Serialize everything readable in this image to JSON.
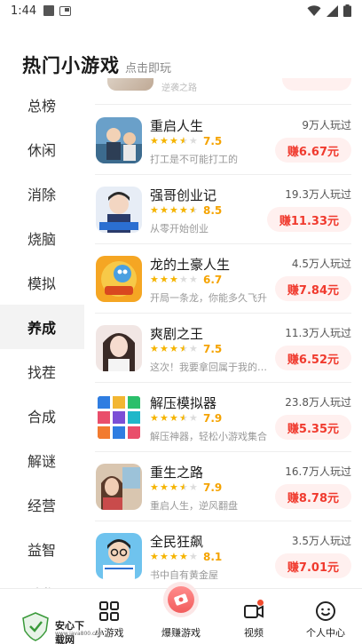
{
  "status_bar": {
    "time": "1:44"
  },
  "header": {
    "title": "热门小游戏",
    "subtitle": "点击即玩"
  },
  "categories": [
    {
      "label": "总榜"
    },
    {
      "label": "休闲"
    },
    {
      "label": "消除"
    },
    {
      "label": "烧脑"
    },
    {
      "label": "模拟"
    },
    {
      "label": "养成",
      "active": true
    },
    {
      "label": "找茬"
    },
    {
      "label": "合成"
    },
    {
      "label": "解谜"
    },
    {
      "label": "经营"
    },
    {
      "label": "益智"
    },
    {
      "label": "动作"
    }
  ],
  "top_partial": {
    "desc": "逆袭之路"
  },
  "games": [
    {
      "name": "重启人生",
      "rating": "7.5",
      "stars": [
        1,
        1,
        1,
        0.5,
        0
      ],
      "desc": "打工是不可能打工的",
      "players": "9万人玩过",
      "earn": "赚6.67元"
    },
    {
      "name": "强哥创业记",
      "rating": "8.5",
      "stars": [
        1,
        1,
        1,
        1,
        0.5
      ],
      "desc": "从零开始创业",
      "players": "19.3万人玩过",
      "earn": "赚11.33元"
    },
    {
      "name": "龙的土豪人生",
      "rating": "6.7",
      "stars": [
        1,
        1,
        1,
        0,
        0
      ],
      "desc": "开局一条龙，你能多久飞升",
      "players": "4.5万人玩过",
      "earn": "赚7.84元"
    },
    {
      "name": "爽剧之王",
      "rating": "7.5",
      "stars": [
        1,
        1,
        1,
        0.5,
        0
      ],
      "desc": "这次！我要拿回属于我的一切",
      "players": "11.3万人玩过",
      "earn": "赚6.52元"
    },
    {
      "name": "解压模拟器",
      "rating": "7.9",
      "stars": [
        1,
        1,
        1,
        0.5,
        0
      ],
      "desc": "解压神器，轻松小游戏集合",
      "players": "23.8万人玩过",
      "earn": "赚5.35元"
    },
    {
      "name": "重生之路",
      "rating": "7.9",
      "stars": [
        1,
        1,
        1,
        0.5,
        0
      ],
      "desc": "重启人生，逆风翻盘",
      "players": "16.7万人玩过",
      "earn": "赚8.78元"
    },
    {
      "name": "全民狂飙",
      "rating": "8.1",
      "stars": [
        1,
        1,
        1,
        1,
        0
      ],
      "desc": "书中自有黄金屋",
      "players": "3.5万人玩过",
      "earn": "赚7.01元"
    }
  ],
  "tabs": {
    "mini_games": "小游戏",
    "hot_games": "爆赚游戏",
    "video": "视频",
    "profile": "个人中心"
  },
  "watermark": {
    "text": "安心下载网",
    "url": "www.java800.com"
  },
  "colors": {
    "accent_red": "#f03a2e",
    "star_yellow": "#f5b400",
    "earn_bg": "#fff0ef"
  }
}
